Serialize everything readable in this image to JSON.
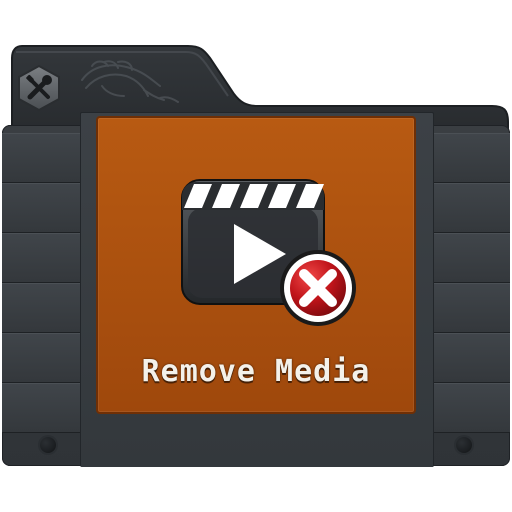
{
  "label": {
    "text": "Remove Media"
  },
  "icons": {
    "settings": "tools-icon",
    "logo": "lion-logo-icon",
    "media": "clapperboard-icon",
    "remove": "close-icon"
  },
  "colors": {
    "label_orange": "#a84c0e",
    "body_dark": "#34383c",
    "remove_red": "#c0141a"
  }
}
